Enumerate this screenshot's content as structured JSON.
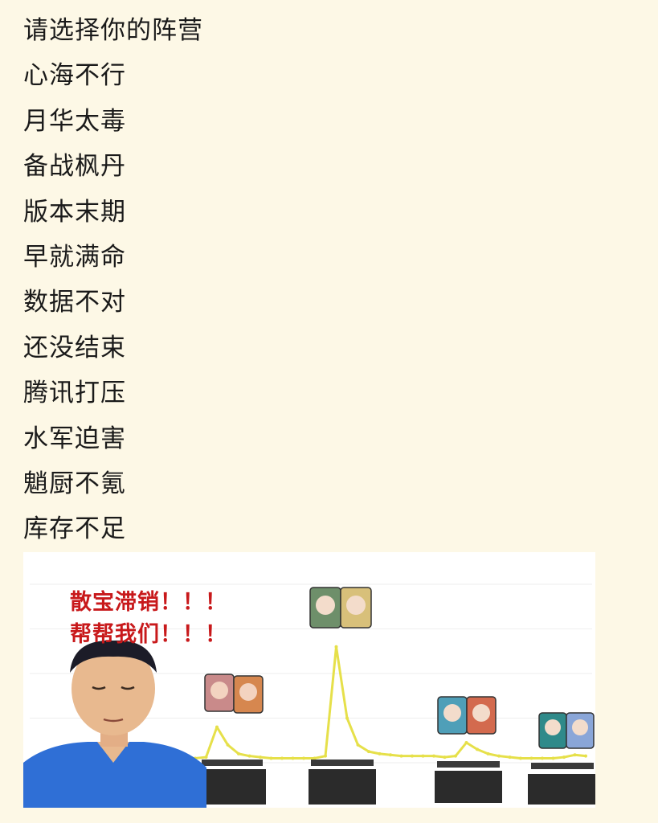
{
  "lines": [
    "请选择你的阵营",
    "心海不行",
    "月华太毒",
    "备战枫丹",
    "版本末期",
    "早就满命",
    "数据不对",
    "还没结束",
    "腾讯打压",
    "水军迫害",
    "魈厨不氪",
    "库存不足"
  ],
  "meme": {
    "caption_line1": "散宝滞销！！！",
    "caption_line2": "帮帮我们！！！"
  },
  "chart_data": {
    "type": "line",
    "x": [
      0,
      1,
      2,
      3,
      4,
      5,
      6,
      7,
      8,
      9,
      10,
      11,
      12,
      13,
      14,
      15,
      16,
      17,
      18,
      19,
      20,
      21,
      22,
      23,
      24,
      25,
      26,
      27,
      28,
      29,
      30,
      31,
      32,
      33,
      34,
      35,
      36,
      37,
      38,
      39,
      40
    ],
    "series": [
      {
        "values": [
          0.2,
          0.2,
          0.2,
          0.2,
          0.2,
          0.25,
          1.6,
          0.8,
          0.4,
          0.3,
          0.25,
          0.2,
          0.2,
          0.2,
          0.2,
          0.2,
          0.3,
          5.2,
          2.0,
          0.8,
          0.5,
          0.4,
          0.35,
          0.3,
          0.3,
          0.3,
          0.3,
          0.25,
          0.3,
          0.9,
          0.6,
          0.4,
          0.3,
          0.25,
          0.2,
          0.2,
          0.2,
          0.2,
          0.25,
          0.35,
          0.3
        ]
      }
    ],
    "ylim": [
      0,
      8
    ],
    "line_color": "#e6e04a",
    "grid": true
  }
}
